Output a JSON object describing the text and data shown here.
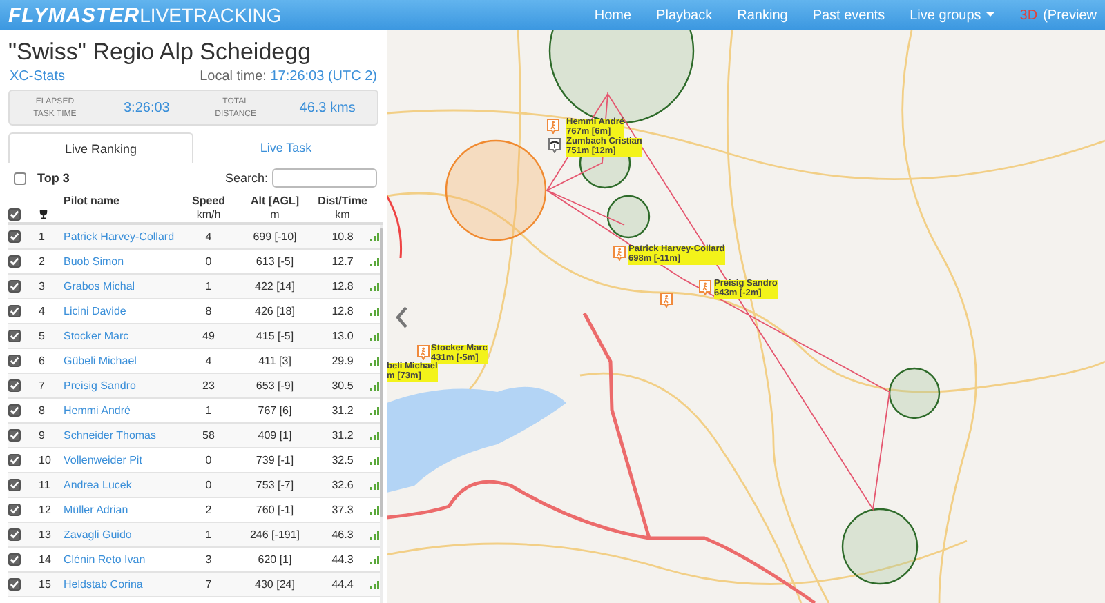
{
  "header": {
    "logo_bold": "FLYMASTER",
    "logo_light": "LIVETRACKING",
    "nav": [
      {
        "label": "Home",
        "kind": "link"
      },
      {
        "label": "Playback",
        "kind": "link"
      },
      {
        "label": "Ranking",
        "kind": "link"
      },
      {
        "label": "Past events",
        "kind": "link"
      },
      {
        "label": "Live groups",
        "kind": "dropdown"
      },
      {
        "label": "3D",
        "kind": "accent"
      },
      {
        "label": "(Preview",
        "kind": "link"
      }
    ]
  },
  "event": {
    "title": "\"Swiss\" Regio Alp Scheidegg",
    "stats_link": "XC-Stats",
    "local_time_label": "Local time:",
    "local_time": "17:26:03 (UTC 2)"
  },
  "stats": [
    {
      "label_top": "ELAPSED",
      "label_bottom": "TASK TIME",
      "value": "3:26:03"
    },
    {
      "label_top": "TOTAL",
      "label_bottom": "DISTANCE",
      "value": "46.3 kms"
    }
  ],
  "tabs": [
    {
      "label": "Live Ranking",
      "selected": true
    },
    {
      "label": "Live Task",
      "selected": false
    }
  ],
  "filter": {
    "label": "Top 3",
    "checked": false
  },
  "search": {
    "label": "Search:"
  },
  "table": {
    "all_checked": true,
    "columns": [
      {
        "label": "Pilot name"
      },
      {
        "label": "Speed",
        "unit": "km/h"
      },
      {
        "label": "Alt [AGL]",
        "unit": "m"
      },
      {
        "label": "Dist/Time",
        "unit": "km"
      }
    ],
    "rows": [
      {
        "checked": true,
        "rank": "1",
        "name": "Patrick Harvey-Collard",
        "speed": "4",
        "alt": "699 [-10]",
        "dist": "10.8"
      },
      {
        "checked": true,
        "rank": "2",
        "name": "Buob Simon",
        "speed": "0",
        "alt": "613 [-5]",
        "dist": "12.7"
      },
      {
        "checked": true,
        "rank": "3",
        "name": "Grabos Michal",
        "speed": "1",
        "alt": "422 [14]",
        "dist": "12.8"
      },
      {
        "checked": true,
        "rank": "4",
        "name": "Licini Davide",
        "speed": "8",
        "alt": "426 [18]",
        "dist": "12.8"
      },
      {
        "checked": true,
        "rank": "5",
        "name": "Stocker Marc",
        "speed": "49",
        "alt": "415 [-5]",
        "dist": "13.0"
      },
      {
        "checked": true,
        "rank": "6",
        "name": "Gübeli Michael",
        "speed": "4",
        "alt": "411 [3]",
        "dist": "29.9"
      },
      {
        "checked": true,
        "rank": "7",
        "name": "Preisig Sandro",
        "speed": "23",
        "alt": "653 [-9]",
        "dist": "30.5"
      },
      {
        "checked": true,
        "rank": "8",
        "name": "Hemmi André",
        "speed": "1",
        "alt": "767 [6]",
        "dist": "31.2"
      },
      {
        "checked": true,
        "rank": "9",
        "name": "Schneider Thomas",
        "speed": "58",
        "alt": "409 [1]",
        "dist": "31.2"
      },
      {
        "checked": true,
        "rank": "10",
        "name": "Vollenweider Pit",
        "speed": "0",
        "alt": "739 [-1]",
        "dist": "32.5"
      },
      {
        "checked": true,
        "rank": "11",
        "name": "Andrea Lucek",
        "speed": "0",
        "alt": "753 [-7]",
        "dist": "32.6"
      },
      {
        "checked": true,
        "rank": "12",
        "name": "Müller Adrian",
        "speed": "2",
        "alt": "760 [-1]",
        "dist": "37.3"
      },
      {
        "checked": true,
        "rank": "13",
        "name": "Zavagli Guido",
        "speed": "1",
        "alt": "246 [-191]",
        "dist": "46.3"
      },
      {
        "checked": true,
        "rank": "14",
        "name": "Clénin Reto Ivan",
        "speed": "3",
        "alt": "620 [1]",
        "dist": "44.3"
      },
      {
        "checked": true,
        "rank": "15",
        "name": "Heldstab Corina",
        "speed": "7",
        "alt": "430 [24]",
        "dist": "44.4"
      }
    ]
  },
  "map": {
    "pilot_labels": [
      {
        "name": "Hemmi André",
        "alt": "767m [6m]",
        "kind": "pilot"
      },
      {
        "name": "Zumbach Cristian",
        "alt": "751m [12m]",
        "kind": "glider"
      },
      {
        "name": "Patrick Harvey-Collard",
        "alt": "698m [-11m]",
        "kind": "pilot"
      },
      {
        "name": "Preisig Sandro",
        "alt": "643m [-2m]",
        "kind": "pilot"
      },
      {
        "name": "Stocker Marc",
        "alt": "431m [-5m]",
        "kind": "pilot"
      },
      {
        "name": "beli Michael",
        "alt": "m [73m]",
        "kind": "none"
      }
    ]
  }
}
